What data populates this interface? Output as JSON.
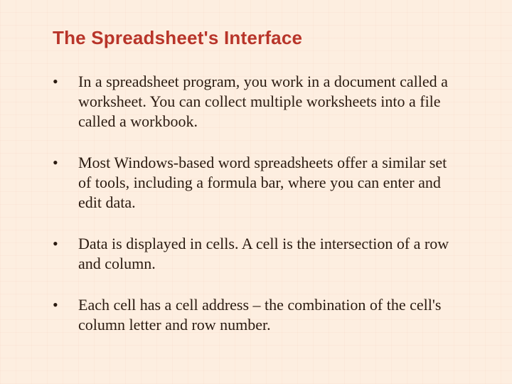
{
  "title": "The Spreadsheet's Interface",
  "bullets": [
    "In a spreadsheet program, you work in a document called a worksheet.  You can collect multiple worksheets into a file called a workbook.",
    "Most Windows-based word spreadsheets offer a similar set of tools, including a formula bar, where you can enter and edit data.",
    "Data is displayed in cells.  A cell is the intersection of a row and column.",
    "Each cell has a cell address – the combination of the cell's column letter and row number."
  ],
  "bullet_glyph": "•"
}
